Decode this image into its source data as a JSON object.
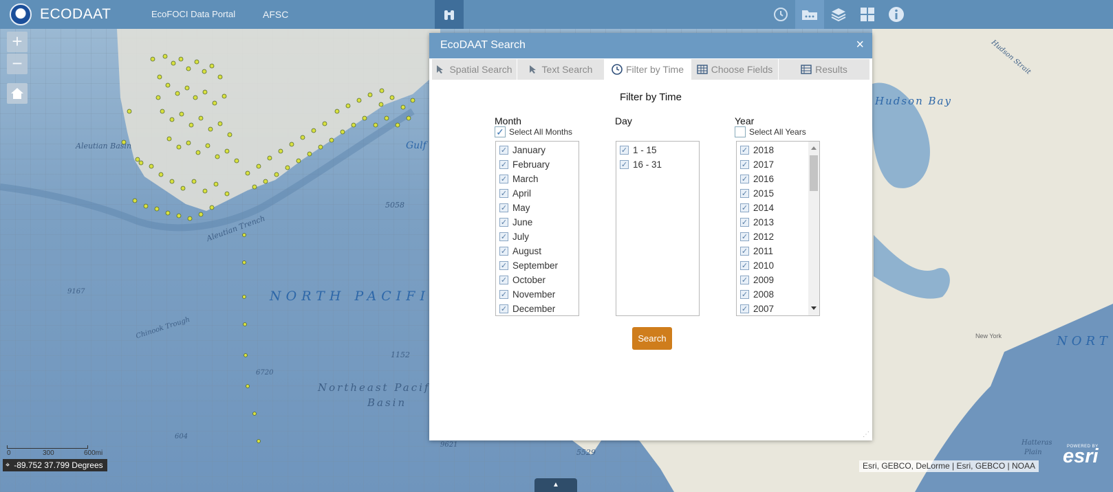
{
  "header": {
    "title": "ECODAAT",
    "nav": [
      "EcoFOCI Data Portal",
      "AFSC"
    ],
    "icons": [
      "binoculars-icon",
      "history-icon",
      "more-icon",
      "layers-icon",
      "grid-icon",
      "info-icon"
    ],
    "bg_color": "#5f8fb8"
  },
  "map": {
    "labels": [
      "Aleutian Basin",
      "Gulf of Alaska",
      "Aleutian Trench",
      "5058",
      "NORTH PACIFIC",
      "9167",
      "Chinook Trough",
      "1152",
      "6720",
      "Northeast Pacific",
      "Basin",
      "604",
      "9621",
      "5529",
      "Hudson Bay",
      "Hudson Strait",
      "New York",
      "NORT",
      "Hatteras",
      "Plain"
    ],
    "zoom_in": "+",
    "zoom_out": "−",
    "coords": "-89.752 37.799 Degrees",
    "scale_labels": [
      "0",
      "300",
      "600mi"
    ],
    "attribution": "Esri, GEBCO, DeLorme | Esri, GEBCO | NOAA",
    "esri_powered": "POWERED BY",
    "esri": "esri"
  },
  "dialog": {
    "title": "EcoDAAT Search",
    "close": "×",
    "tabs": [
      {
        "label": "Spatial Search",
        "icon": "cursor-icon"
      },
      {
        "label": "Text Search",
        "icon": "text-cursor-icon"
      },
      {
        "label": "Filter by Time",
        "icon": "clock-icon"
      },
      {
        "label": "Choose Fields",
        "icon": "table-icon"
      },
      {
        "label": "Results",
        "icon": "table-icon"
      }
    ],
    "heading": "Filter by Time",
    "month": {
      "title": "Month",
      "select_all": "Select All Months",
      "select_all_checked": true,
      "items": [
        "January",
        "February",
        "March",
        "April",
        "May",
        "June",
        "July",
        "August",
        "September",
        "October",
        "November",
        "December"
      ]
    },
    "day": {
      "title": "Day",
      "items": [
        "1 - 15",
        "16 - 31"
      ]
    },
    "year": {
      "title": "Year",
      "select_all": "Select All Years",
      "select_all_checked": false,
      "items": [
        "2018",
        "2017",
        "2016",
        "2015",
        "2014",
        "2013",
        "2012",
        "2011",
        "2010",
        "2009",
        "2008",
        "2007"
      ]
    },
    "search_button": "Search",
    "accent_color": "#cf7d1c"
  }
}
